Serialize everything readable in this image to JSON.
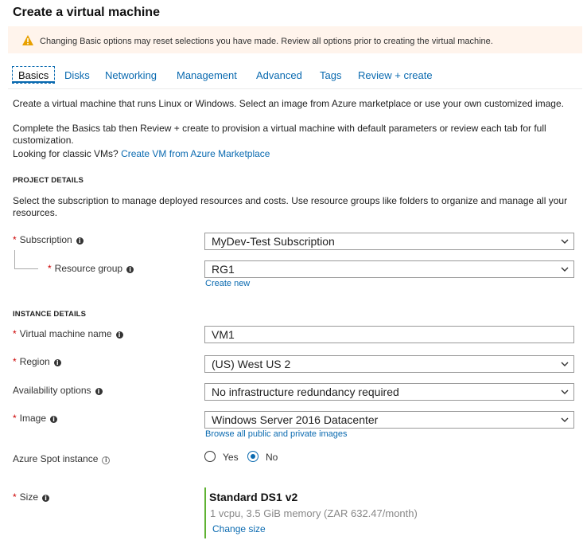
{
  "page": {
    "title": "Create a virtual machine"
  },
  "banner": {
    "text": "Changing Basic options may reset selections you have made. Review all options prior to creating the virtual machine.",
    "icon": "warning-icon",
    "icon_color": "#e8a000"
  },
  "tabs": [
    {
      "label": "Basics",
      "active": true
    },
    {
      "label": "Disks"
    },
    {
      "label": "Networking"
    },
    {
      "label": "Management"
    },
    {
      "label": "Advanced"
    },
    {
      "label": "Tags"
    },
    {
      "label": "Review + create"
    }
  ],
  "intro": {
    "line1": "Create a virtual machine that runs Linux or Windows. Select an image from Azure marketplace or use your own customized image.",
    "line2": "Complete the Basics tab then Review + create to provision a virtual machine with default parameters or review each tab for full customization.",
    "classic_prefix": "Looking for classic VMs?",
    "classic_link": "Create VM from Azure Marketplace"
  },
  "project": {
    "heading": "PROJECT DETAILS",
    "description": "Select the subscription to manage deployed resources and costs. Use resource groups like folders to organize and manage all your resources.",
    "subscription_label": "Subscription",
    "subscription_value": "MyDev-Test Subscription",
    "resource_group_label": "Resource group",
    "resource_group_value": "RG1",
    "create_new": "Create new"
  },
  "instance": {
    "heading": "INSTANCE DETAILS",
    "vm_name_label": "Virtual machine name",
    "vm_name_value": "VM1",
    "region_label": "Region",
    "region_value": "(US) West US 2",
    "availability_label": "Availability options",
    "availability_value": "No infrastructure redundancy required",
    "image_label": "Image",
    "image_value": "Windows Server 2016 Datacenter",
    "browse_images": "Browse all public and private images",
    "spot_label": "Azure Spot instance",
    "spot_yes": "Yes",
    "spot_no": "No",
    "spot_selected": "No",
    "size_label": "Size",
    "size_name": "Standard DS1 v2",
    "size_desc": "1 vcpu, 3.5 GiB memory (ZAR 632.47/month)",
    "change_size": "Change size"
  },
  "colors": {
    "accent": "#0a6ab0",
    "required": "#cc0000",
    "size_bar": "#5fb233"
  }
}
